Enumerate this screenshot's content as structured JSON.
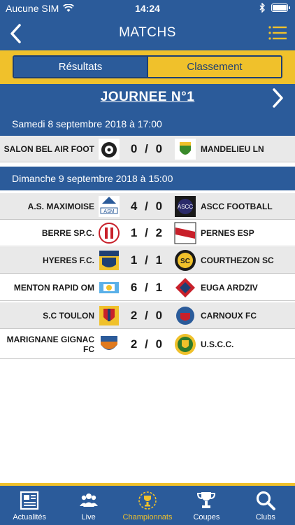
{
  "status": {
    "carrier": "Aucune SIM",
    "time": "14:24"
  },
  "nav": {
    "title": "MATCHS"
  },
  "segments": {
    "results": "Résultats",
    "standings": "Classement"
  },
  "journee": "JOURNEE N°1",
  "days": [
    {
      "date": "Samedi 8 septembre 2018 à 17:00",
      "matches": [
        {
          "home": "SALON BEL AIR FOOT",
          "home_score": "0",
          "sep": "/",
          "away_score": "0",
          "away": "MANDELIEU LN"
        }
      ]
    },
    {
      "date": "Dimanche 9 septembre 2018 à 15:00",
      "matches": [
        {
          "home": "A.S. MAXIMOISE",
          "home_score": "4",
          "sep": "/",
          "away_score": "0",
          "away": "ASCC FOOTBALL"
        },
        {
          "home": "BERRE SP.C.",
          "home_score": "1",
          "sep": "/",
          "away_score": "2",
          "away": "PERNES ESP"
        },
        {
          "home": "HYERES F.C.",
          "home_score": "1",
          "sep": "/",
          "away_score": "1",
          "away": "COURTHEZON SC"
        },
        {
          "home": "MENTON RAPID OM",
          "home_score": "6",
          "sep": "/",
          "away_score": "1",
          "away": "EUGA ARDZIV"
        },
        {
          "home": "S.C TOULON",
          "home_score": "2",
          "sep": "/",
          "away_score": "0",
          "away": "CARNOUX FC"
        },
        {
          "home": "MARIGNANE GIGNAC FC",
          "home_score": "2",
          "sep": "/",
          "away_score": "0",
          "away": "U.S.C.C."
        }
      ]
    }
  ],
  "tabs": [
    {
      "label": "Actualités",
      "icon": "newspaper-icon"
    },
    {
      "label": "Live",
      "icon": "people-icon"
    },
    {
      "label": "Championnats",
      "icon": "trophy-laurel-icon",
      "active": true
    },
    {
      "label": "Coupes",
      "icon": "cup-icon"
    },
    {
      "label": "Clubs",
      "icon": "search-icon"
    }
  ],
  "colors": {
    "primary": "#2b5b9a",
    "accent": "#f0c12b",
    "row_alt": "#e9e9e9"
  }
}
